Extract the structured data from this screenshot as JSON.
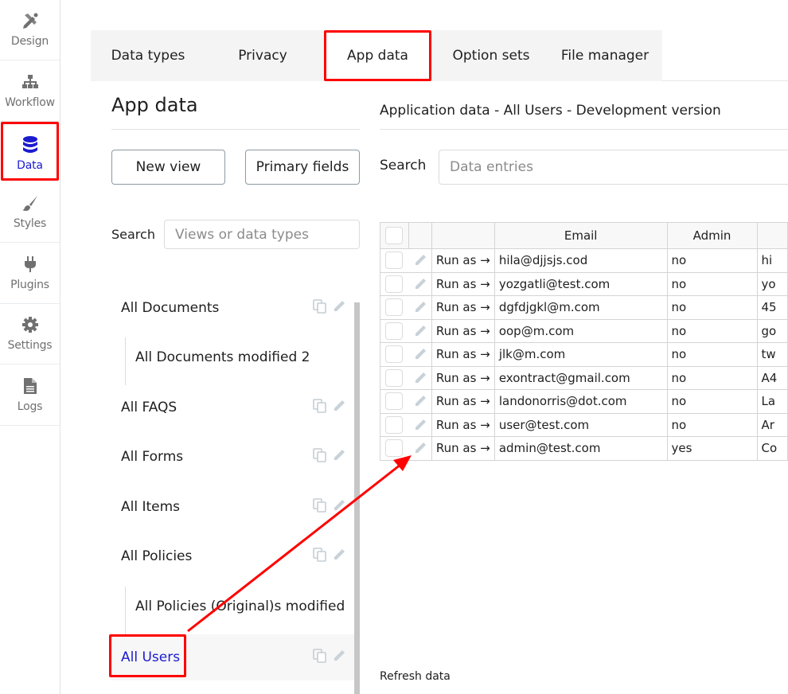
{
  "rail": {
    "items": [
      {
        "label": "Design",
        "icon": "design-icon"
      },
      {
        "label": "Workflow",
        "icon": "workflow-icon"
      },
      {
        "label": "Data",
        "icon": "database-icon",
        "active": true
      },
      {
        "label": "Styles",
        "icon": "brush-icon"
      },
      {
        "label": "Plugins",
        "icon": "plug-icon"
      },
      {
        "label": "Settings",
        "icon": "gear-icon"
      },
      {
        "label": "Logs",
        "icon": "document-icon"
      }
    ]
  },
  "tabs": [
    {
      "label": "Data types"
    },
    {
      "label": "Privacy"
    },
    {
      "label": "App data",
      "active": true
    },
    {
      "label": "Option sets"
    },
    {
      "label": "File manager"
    }
  ],
  "left_panel": {
    "title": "App data",
    "new_view_label": "New view",
    "primary_fields_label": "Primary fields",
    "search_label": "Search",
    "search_placeholder": "Views or data types",
    "views": [
      {
        "name": "All Documents",
        "sub": false
      },
      {
        "name": "All Documents modified 2",
        "sub": true
      },
      {
        "name": "All FAQS",
        "sub": false
      },
      {
        "name": "All Forms",
        "sub": false
      },
      {
        "name": "All Items",
        "sub": false
      },
      {
        "name": "All Policies",
        "sub": false
      },
      {
        "name": "All Policies (Original)s modified",
        "sub": true
      },
      {
        "name": "All Users",
        "sub": false,
        "selected": true
      }
    ]
  },
  "right_panel": {
    "title": "Application data - All Users - Development version",
    "search_label": "Search",
    "search_placeholder": "Data entries",
    "table": {
      "columns": [
        "",
        "",
        "Email",
        "Admin",
        ""
      ],
      "run_as_label": "Run as →",
      "rows": [
        {
          "email": "hila@djjsjs.cod",
          "admin": "no",
          "next": "hi"
        },
        {
          "email": "yozgatli@test.com",
          "admin": "no",
          "next": "yo"
        },
        {
          "email": "dgfdjgkl@m.com",
          "admin": "no",
          "next": "45"
        },
        {
          "email": "oop@m.com",
          "admin": "no",
          "next": "go"
        },
        {
          "email": "jlk@m.com",
          "admin": "no",
          "next": "tw"
        },
        {
          "email": "exontract@gmail.com",
          "admin": "no",
          "next": "A4"
        },
        {
          "email": "landonorris@dot.com",
          "admin": "no",
          "next": "La"
        },
        {
          "email": "user@test.com",
          "admin": "no",
          "next": "Ar"
        },
        {
          "email": "admin@test.com",
          "admin": "yes",
          "next": "Co"
        }
      ]
    },
    "refresh_label": "Refresh data"
  },
  "colors": {
    "accent": "#1b1bd0",
    "highlight": "#ff0000",
    "icon_gray": "#707070"
  }
}
